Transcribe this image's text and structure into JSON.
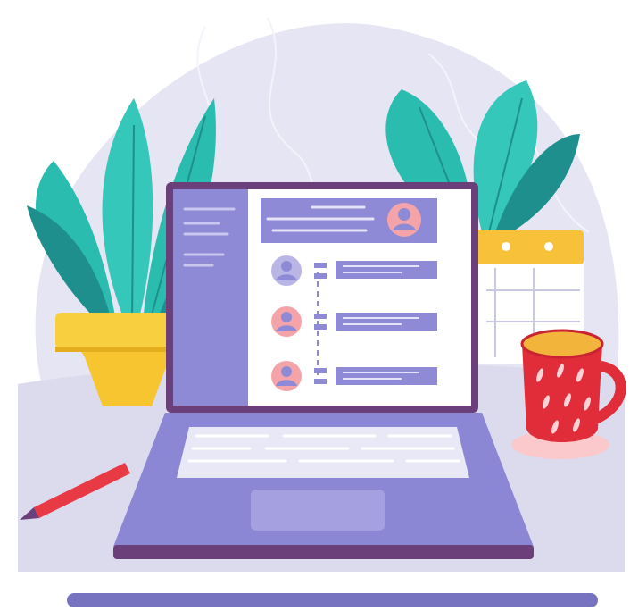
{
  "illustration": {
    "icons": [
      "plant-left-icon",
      "plant-right-icon",
      "laptop-icon",
      "calendar-icon",
      "mug-icon",
      "pencil-icon"
    ],
    "colors": {
      "blob": "#e6e5f3",
      "blob_lines": "#f4f3fb",
      "desk_top": "#dcdbee",
      "desk_edge": "#7873c0",
      "laptop_base": "#8b87d4",
      "laptop_dark": "#6b3f7a",
      "screen_bg": "#ffffff",
      "screen_sidebar": "#8e8ad6",
      "plant_leaf": "#2bbcb0",
      "plant_leaf_dark": "#1e8f8c",
      "pot": "#f6c52f",
      "calendar_top": "#f7c23a",
      "mug": "#e12d3a",
      "tea": "#f3b43b",
      "saucer": "#fbc9cc",
      "pencil": "#e83a45",
      "avatar_pink": "#f4a4a8",
      "avatar_purple": "#8e8ad6"
    },
    "screen": {
      "contact_rows": 3
    }
  }
}
